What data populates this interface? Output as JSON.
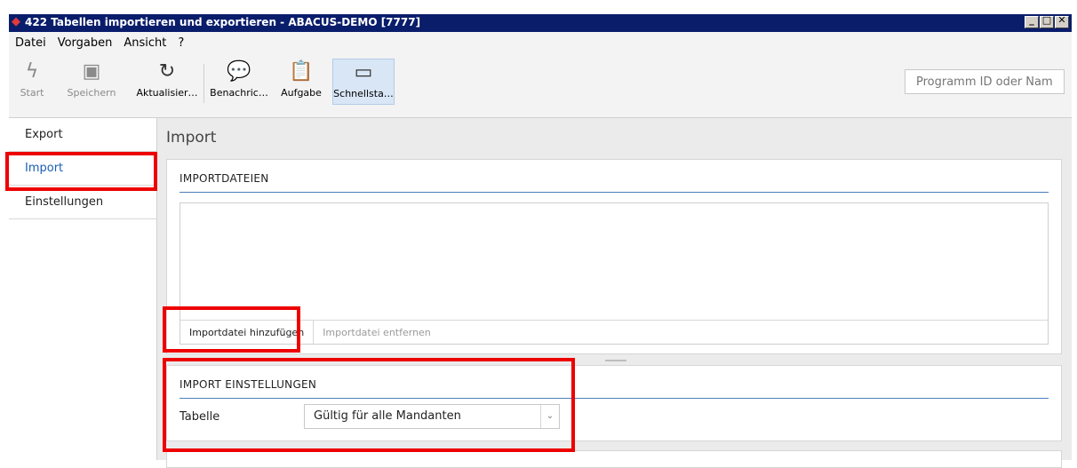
{
  "window": {
    "title": "422 Tabellen importieren und exportieren - ABACUS-DEMO [7777]",
    "app_icon": "abacus-diamond-icon",
    "controls": [
      "_",
      "□",
      "✕"
    ]
  },
  "menu": [
    "Datei",
    "Vorgaben",
    "Ansicht",
    "?"
  ],
  "toolbar": {
    "buttons": [
      {
        "label": "Start",
        "icon": "lightning-icon",
        "enabled": false
      },
      {
        "label": "Speichern",
        "icon": "save-icon",
        "enabled": false
      },
      {
        "label": "Aktualisier…",
        "icon": "refresh-icon",
        "enabled": true
      },
      {
        "label": "Benachric…",
        "icon": "chat-add-icon",
        "enabled": true
      },
      {
        "label": "Aufgabe",
        "icon": "clipboard-add-icon",
        "enabled": true
      },
      {
        "label": "Schnellsta…",
        "icon": "window-icon",
        "enabled": true,
        "active": true
      }
    ],
    "search_placeholder": "Programm ID oder Name"
  },
  "sidebar": {
    "items": [
      {
        "label": "Export",
        "active": false
      },
      {
        "label": "Import",
        "active": true
      },
      {
        "label": "Einstellungen",
        "active": false
      }
    ]
  },
  "main": {
    "title": "Import",
    "import_files": {
      "header": "IMPORTDATEIEN",
      "add_label": "Importdatei hinzufügen",
      "remove_label": "Importdatei entfernen"
    },
    "import_settings": {
      "header": "IMPORT EINSTELLUNGEN",
      "table_label": "Tabelle",
      "table_value": "Gültig für alle Mandanten"
    }
  },
  "colors": {
    "titlebar": "#0a1d6b",
    "accent": "#1b5fb5",
    "highlight": "#ee0000"
  }
}
